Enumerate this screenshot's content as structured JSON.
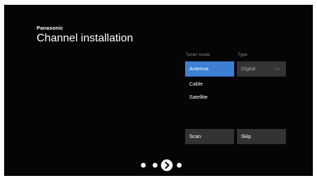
{
  "brand": "Panasonic",
  "title": "Channel installation",
  "tuner": {
    "label": "Tuner mode",
    "options": [
      {
        "label": "Antenna",
        "selected": true
      },
      {
        "label": "Cable",
        "selected": false
      },
      {
        "label": "Satellite",
        "selected": false
      }
    ]
  },
  "type": {
    "label": "Type",
    "value": "Digital"
  },
  "actions": {
    "scan_label": "Scan",
    "skip_label": "Skip"
  },
  "pager": {
    "total_steps": 4,
    "current_step": 3,
    "next_icon": "chevron-right-icon"
  },
  "colors": {
    "background": "#050505",
    "accent": "#3c7fd4",
    "button": "#333333",
    "text": "#ffffff",
    "muted": "#8a8a8a"
  }
}
